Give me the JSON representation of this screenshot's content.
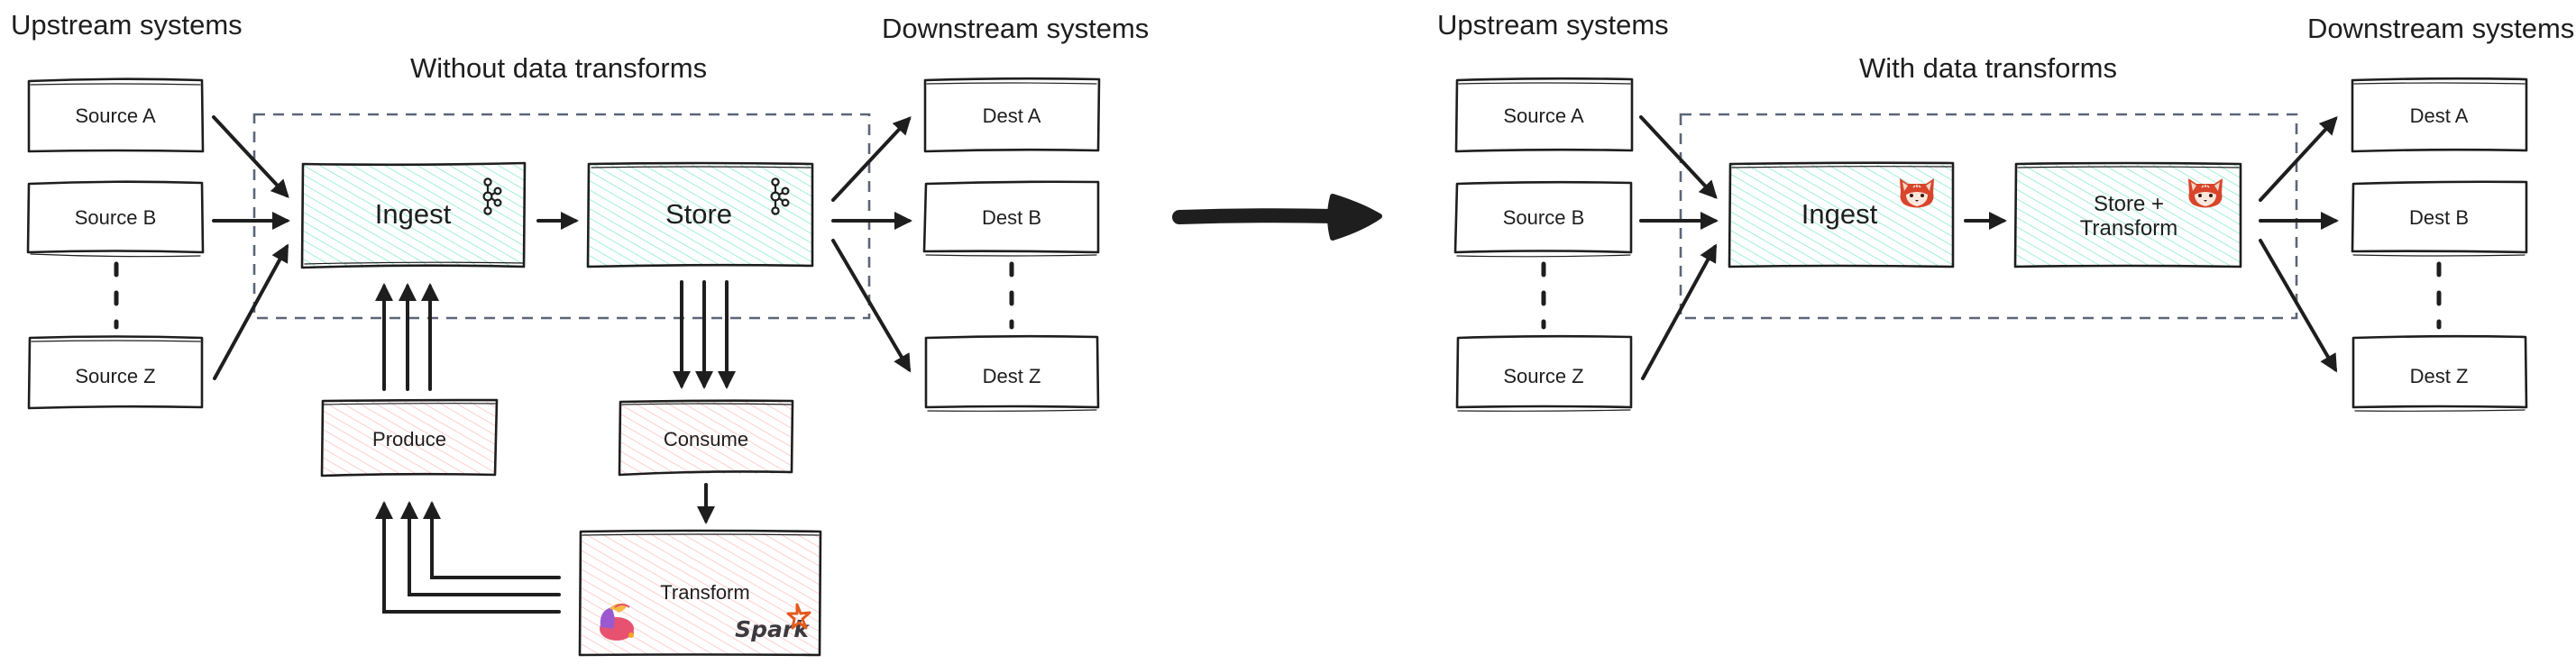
{
  "colors": {
    "ink": "#1e1e1e",
    "frame": "#5c6578",
    "mint_hatch": "#63e6be",
    "pink_hatch": "#ffc9c9",
    "spark_orange": "#e25a1c",
    "panda_red": "#d8452b"
  },
  "left": {
    "upstream_label": "Upstream systems",
    "downstream_label": "Downstream systems",
    "title": "Without data transforms",
    "sources": [
      "Source A",
      "Source B",
      "Source Z"
    ],
    "dests": [
      "Dest A",
      "Dest B",
      "Dest Z"
    ],
    "ingest": {
      "label": "Ingest",
      "icon": "kafka-icon"
    },
    "store": {
      "label": "Store",
      "icon": "kafka-icon"
    },
    "produce": {
      "label": "Produce"
    },
    "consume": {
      "label": "Consume"
    },
    "transform": {
      "label": "Transform",
      "icons": [
        "flink-squirrel-icon",
        "spark-logo-icon"
      ],
      "spark_text": "Spark"
    }
  },
  "transition_arrow": "arrow-right-icon",
  "right": {
    "upstream_label": "Upstream systems",
    "downstream_label": "Downstream systems",
    "title": "With data transforms",
    "sources": [
      "Source A",
      "Source B",
      "Source Z"
    ],
    "dests": [
      "Dest A",
      "Dest B",
      "Dest Z"
    ],
    "ingest": {
      "label": "Ingest",
      "icon": "redpanda-icon"
    },
    "store_transform": {
      "label_line1": "Store +",
      "label_line2": "Transform",
      "icon": "redpanda-icon"
    }
  }
}
